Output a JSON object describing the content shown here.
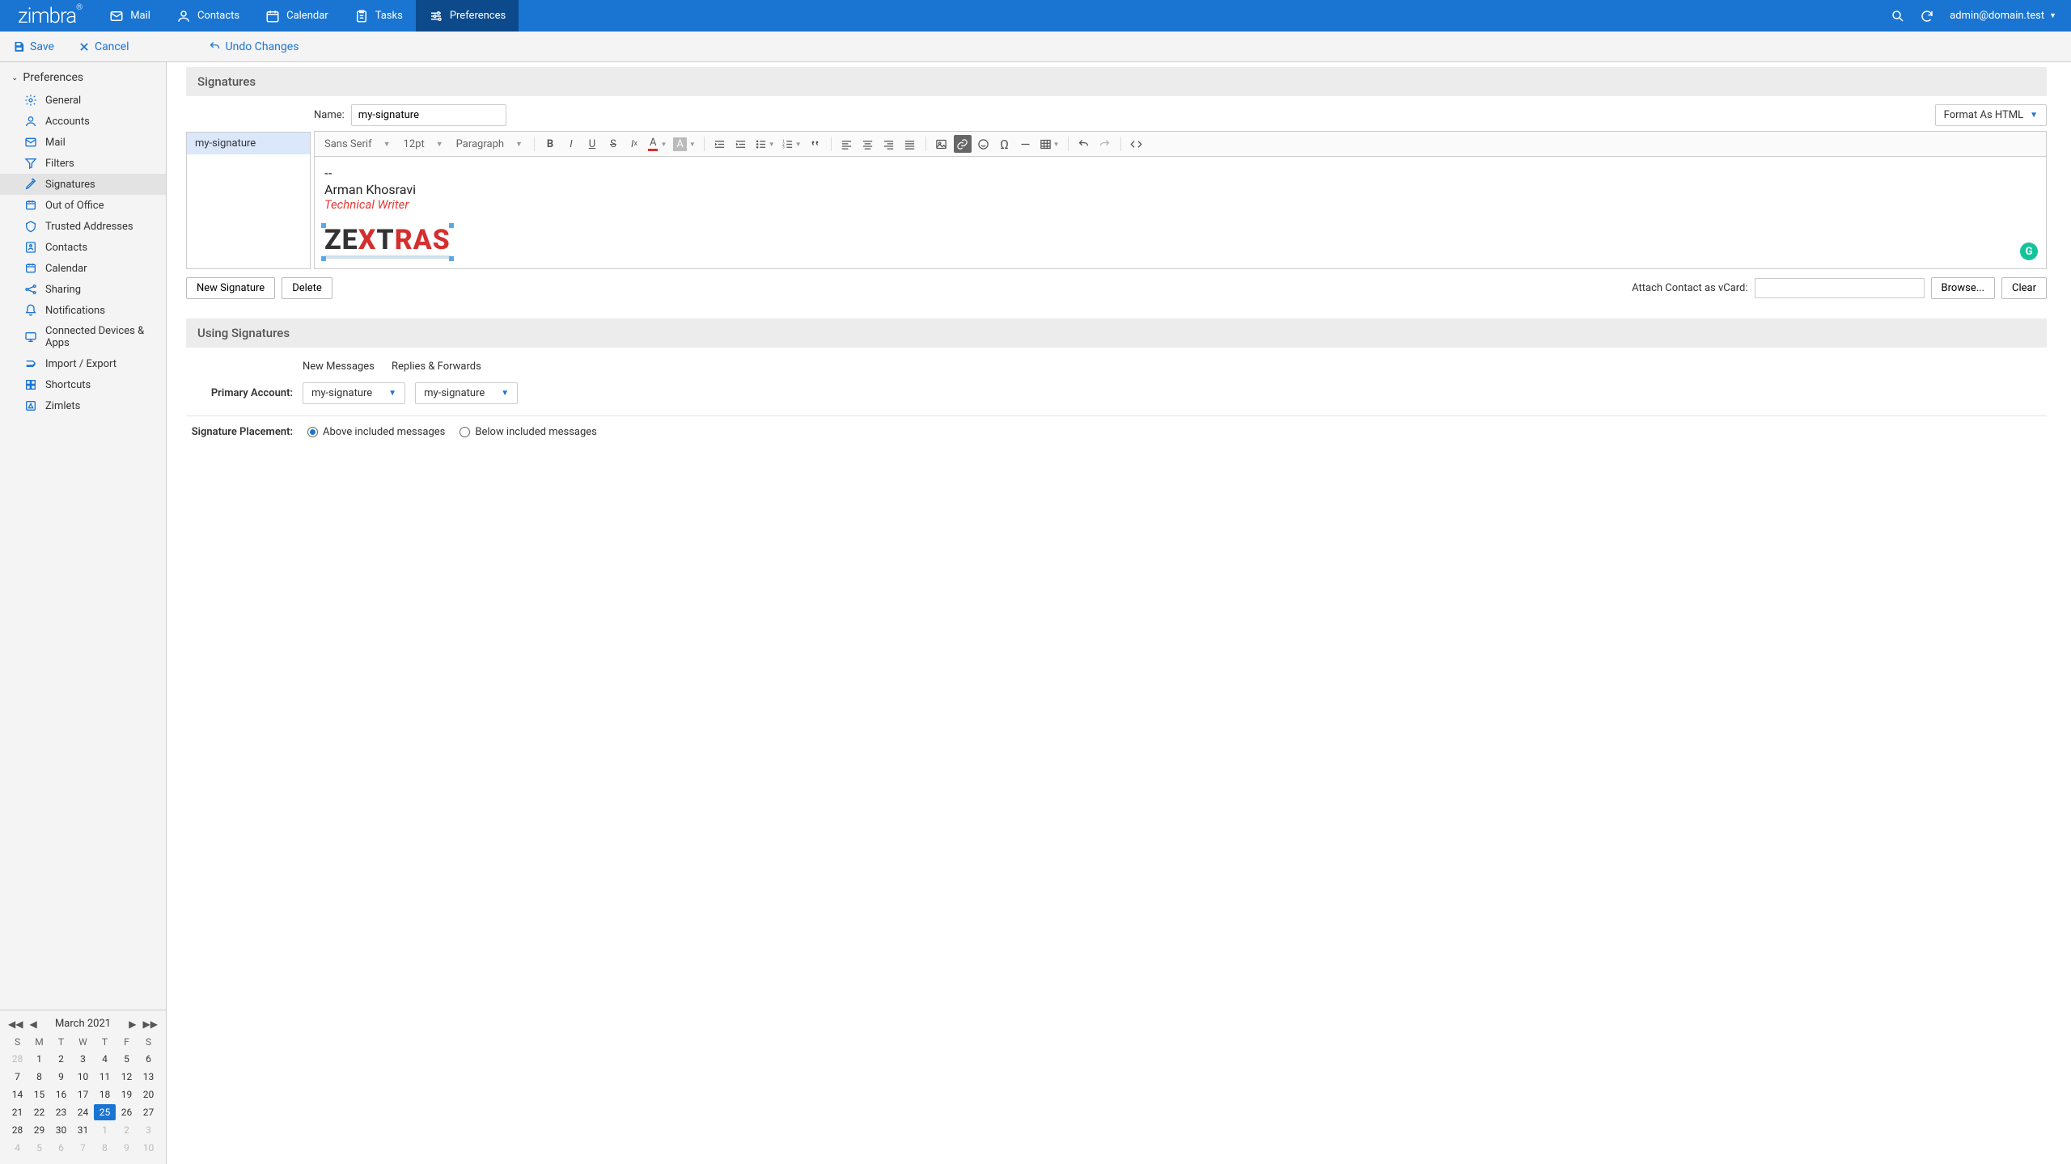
{
  "brand": "zimbra",
  "nav": {
    "mail": "Mail",
    "contacts": "Contacts",
    "calendar": "Calendar",
    "tasks": "Tasks",
    "preferences": "Preferences"
  },
  "user": "admin@domain.test",
  "actions": {
    "save": "Save",
    "cancel": "Cancel",
    "undo": "Undo Changes"
  },
  "sidebar": {
    "header": "Preferences",
    "items": [
      {
        "label": "General"
      },
      {
        "label": "Accounts"
      },
      {
        "label": "Mail"
      },
      {
        "label": "Filters"
      },
      {
        "label": "Signatures"
      },
      {
        "label": "Out of Office"
      },
      {
        "label": "Trusted Addresses"
      },
      {
        "label": "Contacts"
      },
      {
        "label": "Calendar"
      },
      {
        "label": "Sharing"
      },
      {
        "label": "Notifications"
      },
      {
        "label": "Connected Devices & Apps"
      },
      {
        "label": "Import / Export"
      },
      {
        "label": "Shortcuts"
      },
      {
        "label": "Zimlets"
      }
    ]
  },
  "minical": {
    "title": "March 2021",
    "dow": [
      "S",
      "M",
      "T",
      "W",
      "T",
      "F",
      "S"
    ],
    "days": [
      {
        "n": "28",
        "m": 1
      },
      {
        "n": "1"
      },
      {
        "n": "2"
      },
      {
        "n": "3"
      },
      {
        "n": "4"
      },
      {
        "n": "5"
      },
      {
        "n": "6"
      },
      {
        "n": "7"
      },
      {
        "n": "8"
      },
      {
        "n": "9"
      },
      {
        "n": "10"
      },
      {
        "n": "11"
      },
      {
        "n": "12"
      },
      {
        "n": "13"
      },
      {
        "n": "14"
      },
      {
        "n": "15"
      },
      {
        "n": "16"
      },
      {
        "n": "17"
      },
      {
        "n": "18"
      },
      {
        "n": "19"
      },
      {
        "n": "20"
      },
      {
        "n": "21"
      },
      {
        "n": "22"
      },
      {
        "n": "23"
      },
      {
        "n": "24"
      },
      {
        "n": "25",
        "t": 1
      },
      {
        "n": "26"
      },
      {
        "n": "27"
      },
      {
        "n": "28"
      },
      {
        "n": "29"
      },
      {
        "n": "30"
      },
      {
        "n": "31"
      },
      {
        "n": "1",
        "m": 1
      },
      {
        "n": "2",
        "m": 1
      },
      {
        "n": "3",
        "m": 1
      },
      {
        "n": "4",
        "m": 1
      },
      {
        "n": "5",
        "m": 1
      },
      {
        "n": "6",
        "m": 1
      },
      {
        "n": "7",
        "m": 1
      },
      {
        "n": "8",
        "m": 1
      },
      {
        "n": "9",
        "m": 1
      },
      {
        "n": "10",
        "m": 1
      }
    ]
  },
  "sections": {
    "signatures": "Signatures",
    "using": "Using Signatures"
  },
  "sigPanel": {
    "nameLabel": "Name:",
    "nameValue": "my-signature",
    "formatLabel": "Format As HTML",
    "listItem": "my-signature",
    "font": "Sans Serif",
    "size": "12pt",
    "block": "Paragraph",
    "sigPerson": "Arman Khosravi",
    "sigTitle": "Technical Writer",
    "newBtn": "New Signature",
    "deleteBtn": "Delete",
    "vcardLabel": "Attach Contact as vCard:",
    "browse": "Browse...",
    "clear": "Clear"
  },
  "using": {
    "colNew": "New Messages",
    "colReply": "Replies & Forwards",
    "primaryLabel": "Primary Account:",
    "primaryNew": "my-signature",
    "primaryReply": "my-signature",
    "placementLabel": "Signature Placement:",
    "optAbove": "Above included messages",
    "optBelow": "Below included messages"
  }
}
